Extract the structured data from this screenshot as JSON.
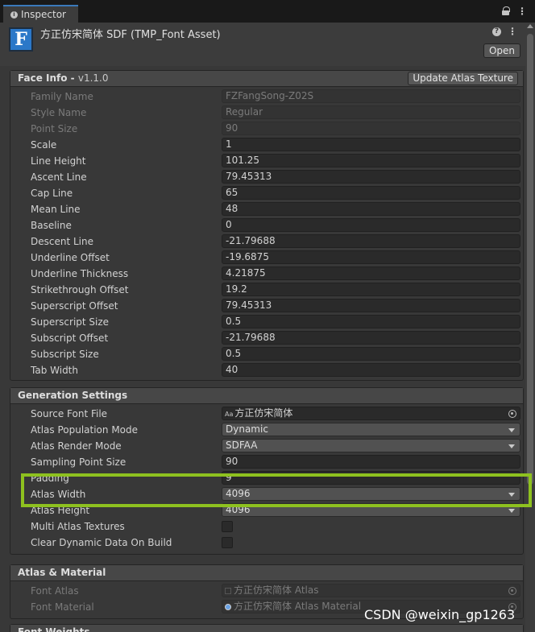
{
  "tab": {
    "label": "Inspector"
  },
  "header": {
    "title": "方正仿宋简体 SDF (TMP_Font Asset)",
    "open_label": "Open",
    "asset_icon_letter": "F"
  },
  "face_info": {
    "title": "Face Info - ",
    "version": "v1.1.0",
    "update_button": "Update Atlas Texture",
    "rows": [
      {
        "label": "Family Name",
        "value": "FZFangSong-Z02S",
        "disabled": true
      },
      {
        "label": "Style Name",
        "value": "Regular",
        "disabled": true
      },
      {
        "label": "Point Size",
        "value": "90",
        "disabled": true
      },
      {
        "label": "Scale",
        "value": "1"
      },
      {
        "label": "Line Height",
        "value": "101.25"
      },
      {
        "label": "Ascent Line",
        "value": "79.45313"
      },
      {
        "label": "Cap Line",
        "value": "65"
      },
      {
        "label": "Mean Line",
        "value": "48"
      },
      {
        "label": "Baseline",
        "value": "0"
      },
      {
        "label": "Descent Line",
        "value": "-21.79688"
      },
      {
        "label": "Underline Offset",
        "value": "-19.6875"
      },
      {
        "label": "Underline Thickness",
        "value": "4.21875"
      },
      {
        "label": "Strikethrough Offset",
        "value": "19.2"
      },
      {
        "label": "Superscript Offset",
        "value": "79.45313"
      },
      {
        "label": "Superscript Size",
        "value": "0.5"
      },
      {
        "label": "Subscript Offset",
        "value": "-21.79688"
      },
      {
        "label": "Subscript Size",
        "value": "0.5"
      },
      {
        "label": "Tab Width",
        "value": "40"
      }
    ]
  },
  "generation": {
    "title": "Generation Settings",
    "source_font_file": {
      "label": "Source Font File",
      "icon": "Aa",
      "value": "方正仿宋简体"
    },
    "atlas_population_mode": {
      "label": "Atlas Population Mode",
      "value": "Dynamic"
    },
    "atlas_render_mode": {
      "label": "Atlas Render Mode",
      "value": "SDFAA"
    },
    "sampling_point_size": {
      "label": "Sampling Point Size",
      "value": "90"
    },
    "padding": {
      "label": "Padding",
      "value": "9"
    },
    "atlas_width": {
      "label": "Atlas Width",
      "value": "4096"
    },
    "atlas_height": {
      "label": "Atlas Height",
      "value": "4096"
    },
    "multi_atlas": {
      "label": "Multi Atlas Textures"
    },
    "clear_dynamic": {
      "label": "Clear Dynamic Data On Build"
    }
  },
  "atlas_material": {
    "title": "Atlas & Material",
    "font_atlas": {
      "label": "Font Atlas",
      "value": "方正仿宋简体 Atlas"
    },
    "font_material": {
      "label": "Font Material",
      "value": "方正仿宋简体 Atlas Material"
    }
  },
  "font_weights": {
    "title": "Font Weights"
  },
  "watermark": "CSDN @weixin_gp1263",
  "colors": {
    "highlight": "#8ec11f",
    "accent": "#3a79bb"
  }
}
